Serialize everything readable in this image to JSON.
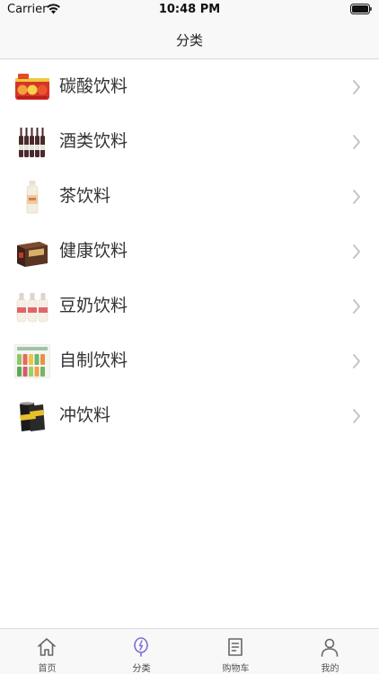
{
  "status_bar": {
    "carrier": "Carrier",
    "time": "10:48 PM"
  },
  "nav": {
    "title": "分类"
  },
  "categories": [
    {
      "label": "碳酸饮料",
      "icon": "carbonated-drinks-thumbnail"
    },
    {
      "label": "酒类饮料",
      "icon": "alcohol-bottles-thumbnail"
    },
    {
      "label": "茶饮料",
      "icon": "tea-bottle-thumbnail"
    },
    {
      "label": "健康饮料",
      "icon": "health-drink-box-thumbnail"
    },
    {
      "label": "豆奶饮料",
      "icon": "soy-milk-bottles-thumbnail"
    },
    {
      "label": "自制饮料",
      "icon": "homemade-drinks-thumbnail"
    },
    {
      "label": "冲饮料",
      "icon": "energy-drink-can-thumbnail"
    }
  ],
  "tabs": [
    {
      "label": "首页",
      "icon": "home-icon"
    },
    {
      "label": "分类",
      "icon": "category-icon",
      "active": true
    },
    {
      "label": "购物车",
      "icon": "cart-icon"
    },
    {
      "label": "我的",
      "icon": "profile-icon"
    }
  ],
  "colors": {
    "active_tab_accent": "#7b6fd6",
    "bar_background": "#f8f8f8",
    "chevron": "#c4c4c7"
  }
}
